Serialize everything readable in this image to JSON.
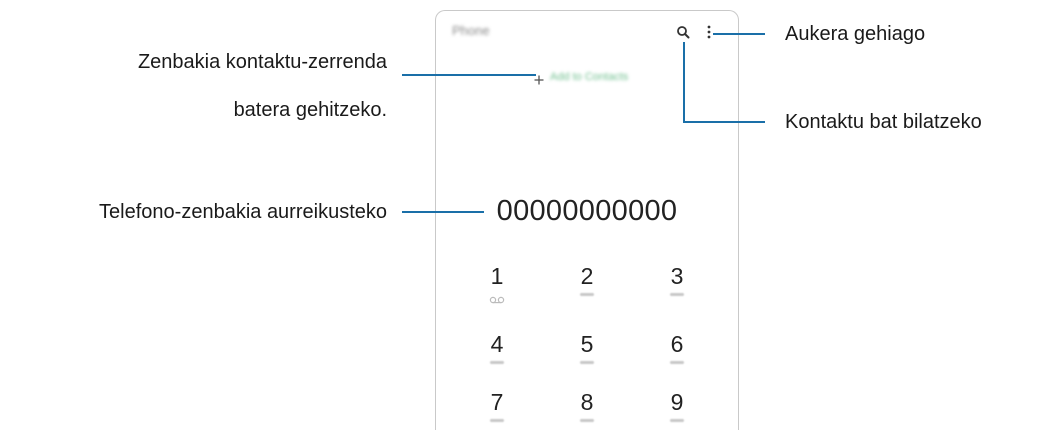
{
  "app": {
    "title": "Phone",
    "add_contact_label": "Add to Contacts",
    "number": "00000000000"
  },
  "keypad": {
    "keys": [
      {
        "digit": "1"
      },
      {
        "digit": "2"
      },
      {
        "digit": "3"
      },
      {
        "digit": "4"
      },
      {
        "digit": "5"
      },
      {
        "digit": "6"
      },
      {
        "digit": "7"
      },
      {
        "digit": "8"
      },
      {
        "digit": "9"
      }
    ]
  },
  "callouts": {
    "add_contact": {
      "line1": "Zenbakia kontaktu-zerrenda",
      "line2": "batera gehitzeko."
    },
    "preview": "Telefono-zenbakia aurreikusteko",
    "more_options": "Aukera gehiago",
    "search": "Kontaktu bat bilatzeko"
  },
  "colors": {
    "callout_line": "#1a6fa8",
    "accent_green": "#6fbf8e"
  },
  "icons": {
    "search": "search-icon",
    "more": "more-options-icon",
    "plus": "plus-icon",
    "voicemail": "voicemail-icon"
  }
}
